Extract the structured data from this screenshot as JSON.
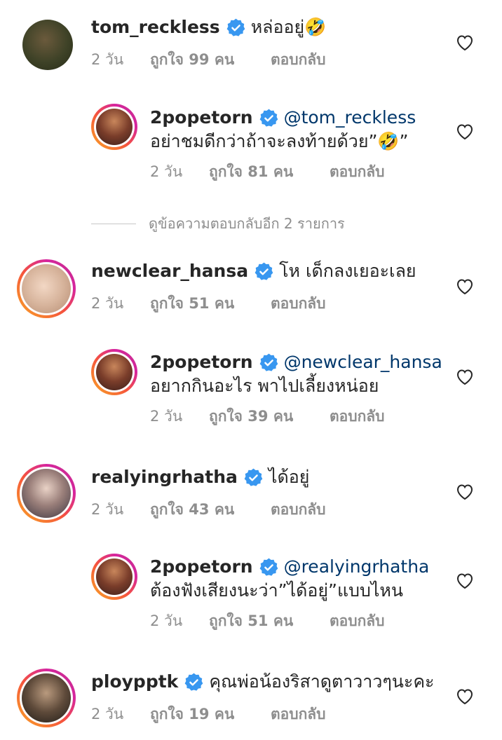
{
  "comments": [
    {
      "username": "tom_reckless",
      "text": "หล่ออยู่🤣",
      "time": "2 วัน",
      "likes": "ถูกใจ 99 คน",
      "reply": "ตอบกลับ"
    },
    {
      "username": "2popetorn",
      "mention": "@tom_reckless",
      "text": "อย่าชมดีกว่าถ้าจะลงท้ายด้วย”🤣”",
      "time": "2 วัน",
      "likes": "ถูกใจ 81 คน",
      "reply": "ตอบกลับ"
    },
    {
      "username": "newclear_hansa",
      "text": "โห เด็กลงเยอะเลย",
      "time": "2 วัน",
      "likes": "ถูกใจ 51 คน",
      "reply": "ตอบกลับ"
    },
    {
      "username": "2popetorn",
      "mention": "@newclear_hansa",
      "text": "อยากกินอะไร พาไปเลี้ยงหน่อย",
      "time": "2 วัน",
      "likes": "ถูกใจ 39 คน",
      "reply": "ตอบกลับ"
    },
    {
      "username": "realyingrhatha",
      "text": "ได้อยู่",
      "time": "2 วัน",
      "likes": "ถูกใจ 43 คน",
      "reply": "ตอบกลับ"
    },
    {
      "username": "2popetorn",
      "mention": "@realyingrhatha",
      "text": "ต้องฟังเสียงนะว่า”ได้อยู่”แบบไหน",
      "time": "2 วัน",
      "likes": "ถูกใจ 51 คน",
      "reply": "ตอบกลับ"
    },
    {
      "username": "ploypptk",
      "text": "คุณพ่อน้องริสาดูตาวาวๆนะคะ",
      "time": "2 วัน",
      "likes": "ถูกใจ 19 คน",
      "reply": "ตอบกลับ"
    }
  ],
  "view_more_replies": "ดูข้อความตอบกลับอีก 2 รายการ",
  "colors": {
    "verified": "#3897f0",
    "mention": "#00376b",
    "meta": "#8e8e8e",
    "text": "#262626"
  },
  "icons": {
    "verified": "verified-badge-icon",
    "like": "heart-outline-icon"
  }
}
